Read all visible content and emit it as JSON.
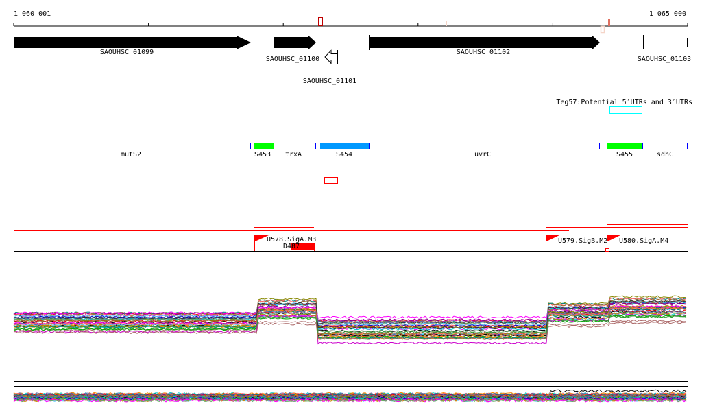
{
  "ruler": {
    "start_label": "1 060 001",
    "end_label": "1 065 000"
  },
  "genes": [
    {
      "id": "SAOUHSC_01099",
      "strand": "+",
      "style": "filled"
    },
    {
      "id": "SAOUHSC_01100",
      "strand": "+",
      "style": "filled"
    },
    {
      "id": "SAOUHSC_01101",
      "strand": "-",
      "style": "open"
    },
    {
      "id": "SAOUHSC_01102",
      "strand": "+",
      "style": "filled"
    },
    {
      "id": "SAOUHSC_01103",
      "strand": "+",
      "style": "open"
    }
  ],
  "teg57": {
    "label": "Teg57:Potential 5′UTRs and 3′UTRs",
    "color": "#00ffff"
  },
  "features": [
    {
      "label": "mutS2",
      "color": "#0000ff",
      "fill": false
    },
    {
      "label": "S453",
      "color": "#00ff00",
      "fill": true
    },
    {
      "label": "trxA",
      "color": "#0000ff",
      "fill": false
    },
    {
      "label": "S454",
      "color": "#0099ff",
      "fill": true
    },
    {
      "label": "uvrC",
      "color": "#0000ff",
      "fill": false
    },
    {
      "label": "S455",
      "color": "#00ff00",
      "fill": true
    },
    {
      "label": "sdhC",
      "color": "#0000ff",
      "fill": false
    }
  ],
  "promoters": [
    {
      "label": "U578.SigA.M3"
    },
    {
      "label": "U579.SigB.M2"
    },
    {
      "label": "U580.SigA.M4"
    }
  ],
  "terminator": {
    "label": "D487",
    "color": "#ff0000"
  },
  "colors": {
    "accent": "#ff0000",
    "gene": "#000000"
  }
}
